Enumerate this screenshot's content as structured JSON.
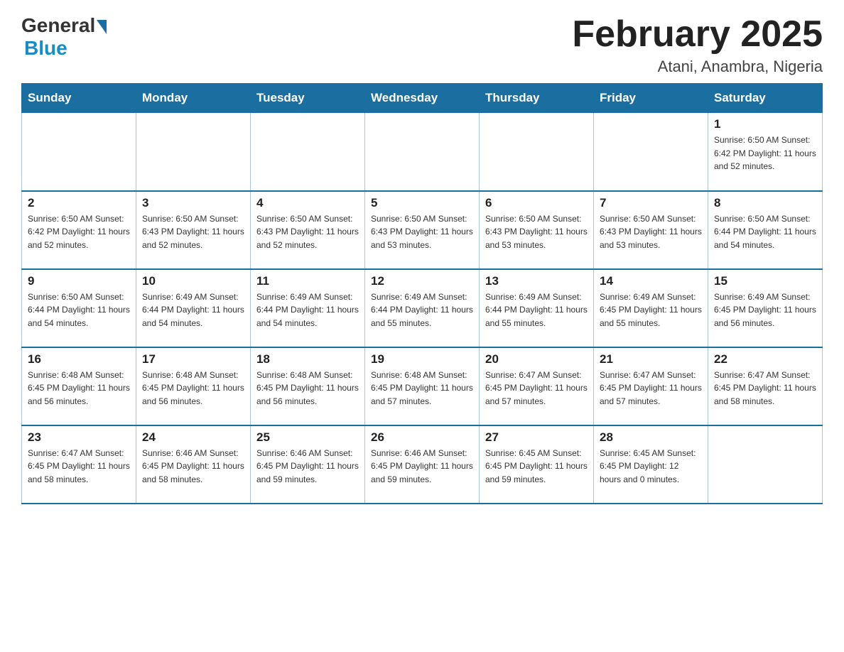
{
  "logo": {
    "general": "General",
    "blue": "Blue"
  },
  "title": "February 2025",
  "location": "Atani, Anambra, Nigeria",
  "days_of_week": [
    "Sunday",
    "Monday",
    "Tuesday",
    "Wednesday",
    "Thursday",
    "Friday",
    "Saturday"
  ],
  "weeks": [
    [
      {
        "day": "",
        "info": ""
      },
      {
        "day": "",
        "info": ""
      },
      {
        "day": "",
        "info": ""
      },
      {
        "day": "",
        "info": ""
      },
      {
        "day": "",
        "info": ""
      },
      {
        "day": "",
        "info": ""
      },
      {
        "day": "1",
        "info": "Sunrise: 6:50 AM\nSunset: 6:42 PM\nDaylight: 11 hours\nand 52 minutes."
      }
    ],
    [
      {
        "day": "2",
        "info": "Sunrise: 6:50 AM\nSunset: 6:42 PM\nDaylight: 11 hours\nand 52 minutes."
      },
      {
        "day": "3",
        "info": "Sunrise: 6:50 AM\nSunset: 6:43 PM\nDaylight: 11 hours\nand 52 minutes."
      },
      {
        "day": "4",
        "info": "Sunrise: 6:50 AM\nSunset: 6:43 PM\nDaylight: 11 hours\nand 52 minutes."
      },
      {
        "day": "5",
        "info": "Sunrise: 6:50 AM\nSunset: 6:43 PM\nDaylight: 11 hours\nand 53 minutes."
      },
      {
        "day": "6",
        "info": "Sunrise: 6:50 AM\nSunset: 6:43 PM\nDaylight: 11 hours\nand 53 minutes."
      },
      {
        "day": "7",
        "info": "Sunrise: 6:50 AM\nSunset: 6:43 PM\nDaylight: 11 hours\nand 53 minutes."
      },
      {
        "day": "8",
        "info": "Sunrise: 6:50 AM\nSunset: 6:44 PM\nDaylight: 11 hours\nand 54 minutes."
      }
    ],
    [
      {
        "day": "9",
        "info": "Sunrise: 6:50 AM\nSunset: 6:44 PM\nDaylight: 11 hours\nand 54 minutes."
      },
      {
        "day": "10",
        "info": "Sunrise: 6:49 AM\nSunset: 6:44 PM\nDaylight: 11 hours\nand 54 minutes."
      },
      {
        "day": "11",
        "info": "Sunrise: 6:49 AM\nSunset: 6:44 PM\nDaylight: 11 hours\nand 54 minutes."
      },
      {
        "day": "12",
        "info": "Sunrise: 6:49 AM\nSunset: 6:44 PM\nDaylight: 11 hours\nand 55 minutes."
      },
      {
        "day": "13",
        "info": "Sunrise: 6:49 AM\nSunset: 6:44 PM\nDaylight: 11 hours\nand 55 minutes."
      },
      {
        "day": "14",
        "info": "Sunrise: 6:49 AM\nSunset: 6:45 PM\nDaylight: 11 hours\nand 55 minutes."
      },
      {
        "day": "15",
        "info": "Sunrise: 6:49 AM\nSunset: 6:45 PM\nDaylight: 11 hours\nand 56 minutes."
      }
    ],
    [
      {
        "day": "16",
        "info": "Sunrise: 6:48 AM\nSunset: 6:45 PM\nDaylight: 11 hours\nand 56 minutes."
      },
      {
        "day": "17",
        "info": "Sunrise: 6:48 AM\nSunset: 6:45 PM\nDaylight: 11 hours\nand 56 minutes."
      },
      {
        "day": "18",
        "info": "Sunrise: 6:48 AM\nSunset: 6:45 PM\nDaylight: 11 hours\nand 56 minutes."
      },
      {
        "day": "19",
        "info": "Sunrise: 6:48 AM\nSunset: 6:45 PM\nDaylight: 11 hours\nand 57 minutes."
      },
      {
        "day": "20",
        "info": "Sunrise: 6:47 AM\nSunset: 6:45 PM\nDaylight: 11 hours\nand 57 minutes."
      },
      {
        "day": "21",
        "info": "Sunrise: 6:47 AM\nSunset: 6:45 PM\nDaylight: 11 hours\nand 57 minutes."
      },
      {
        "day": "22",
        "info": "Sunrise: 6:47 AM\nSunset: 6:45 PM\nDaylight: 11 hours\nand 58 minutes."
      }
    ],
    [
      {
        "day": "23",
        "info": "Sunrise: 6:47 AM\nSunset: 6:45 PM\nDaylight: 11 hours\nand 58 minutes."
      },
      {
        "day": "24",
        "info": "Sunrise: 6:46 AM\nSunset: 6:45 PM\nDaylight: 11 hours\nand 58 minutes."
      },
      {
        "day": "25",
        "info": "Sunrise: 6:46 AM\nSunset: 6:45 PM\nDaylight: 11 hours\nand 59 minutes."
      },
      {
        "day": "26",
        "info": "Sunrise: 6:46 AM\nSunset: 6:45 PM\nDaylight: 11 hours\nand 59 minutes."
      },
      {
        "day": "27",
        "info": "Sunrise: 6:45 AM\nSunset: 6:45 PM\nDaylight: 11 hours\nand 59 minutes."
      },
      {
        "day": "28",
        "info": "Sunrise: 6:45 AM\nSunset: 6:45 PM\nDaylight: 12 hours\nand 0 minutes."
      },
      {
        "day": "",
        "info": ""
      }
    ]
  ]
}
